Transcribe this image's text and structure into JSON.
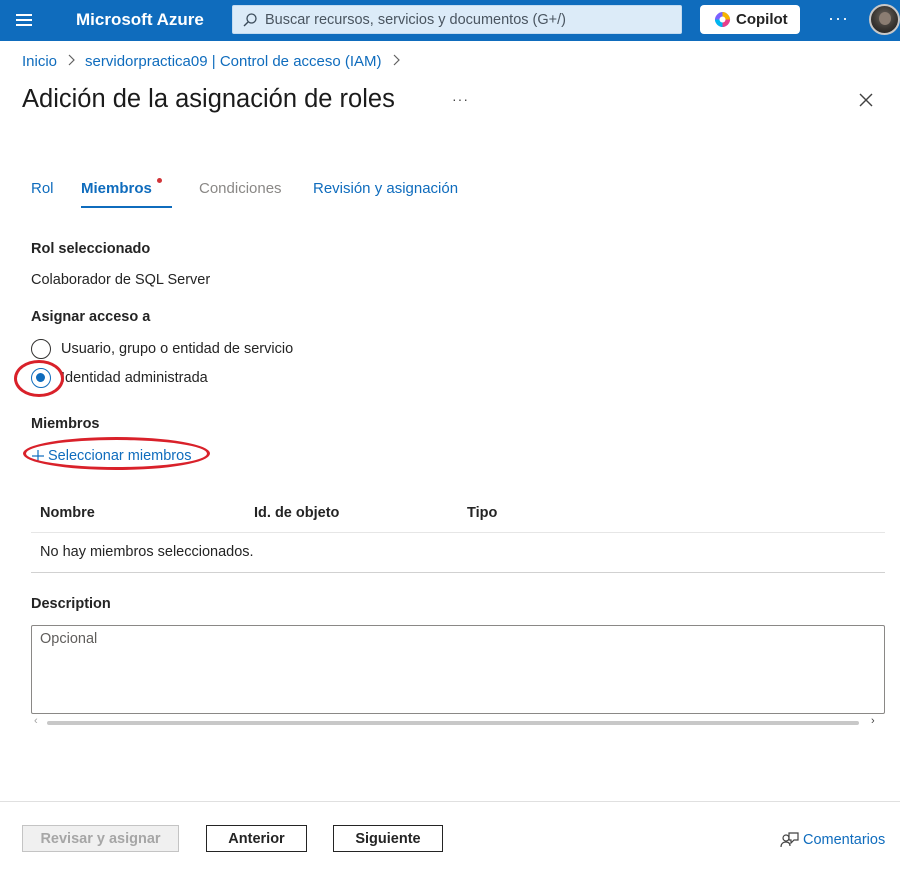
{
  "topbar": {
    "brand": "Microsoft Azure",
    "search_placeholder": "Buscar recursos, servicios y documentos (G+/)",
    "copilot_label": "Copilot",
    "more": "···",
    "accent": "#0f6cbd"
  },
  "breadcrumb": {
    "home": "Inicio",
    "resource": "servidorpractica09 | Control de acceso (IAM)",
    "separator": ">"
  },
  "page": {
    "title": "Adición de la asignación de roles",
    "more": "···"
  },
  "tabs": [
    {
      "label": "Rol",
      "state": "link"
    },
    {
      "label": "Miembros",
      "state": "active"
    },
    {
      "label": "Condiciones",
      "state": "disabled"
    },
    {
      "label": "Revisión y asignación",
      "state": "link"
    }
  ],
  "form": {
    "selected_role_label": "Rol seleccionado",
    "selected_role_value": "Colaborador de SQL Server",
    "assign_access_label": "Asignar acceso a",
    "options": [
      {
        "label": "Usuario, grupo o entidad de servicio",
        "checked": false
      },
      {
        "label": "Identidad administrada",
        "checked": true
      }
    ],
    "members_label": "Miembros",
    "select_members_label": "Seleccionar miembros"
  },
  "table": {
    "columns": [
      "Nombre",
      "Id. de objeto",
      "Tipo"
    ],
    "empty_text": "No hay miembros seleccionados."
  },
  "description": {
    "label": "Description",
    "placeholder": "Opcional",
    "value": ""
  },
  "footer": {
    "review_label": "Revisar y asignar",
    "prev_label": "Anterior",
    "next_label": "Siguiente",
    "feedback_label": "Comentarios"
  },
  "annotations": {
    "highlight_color": "#d9212a"
  }
}
